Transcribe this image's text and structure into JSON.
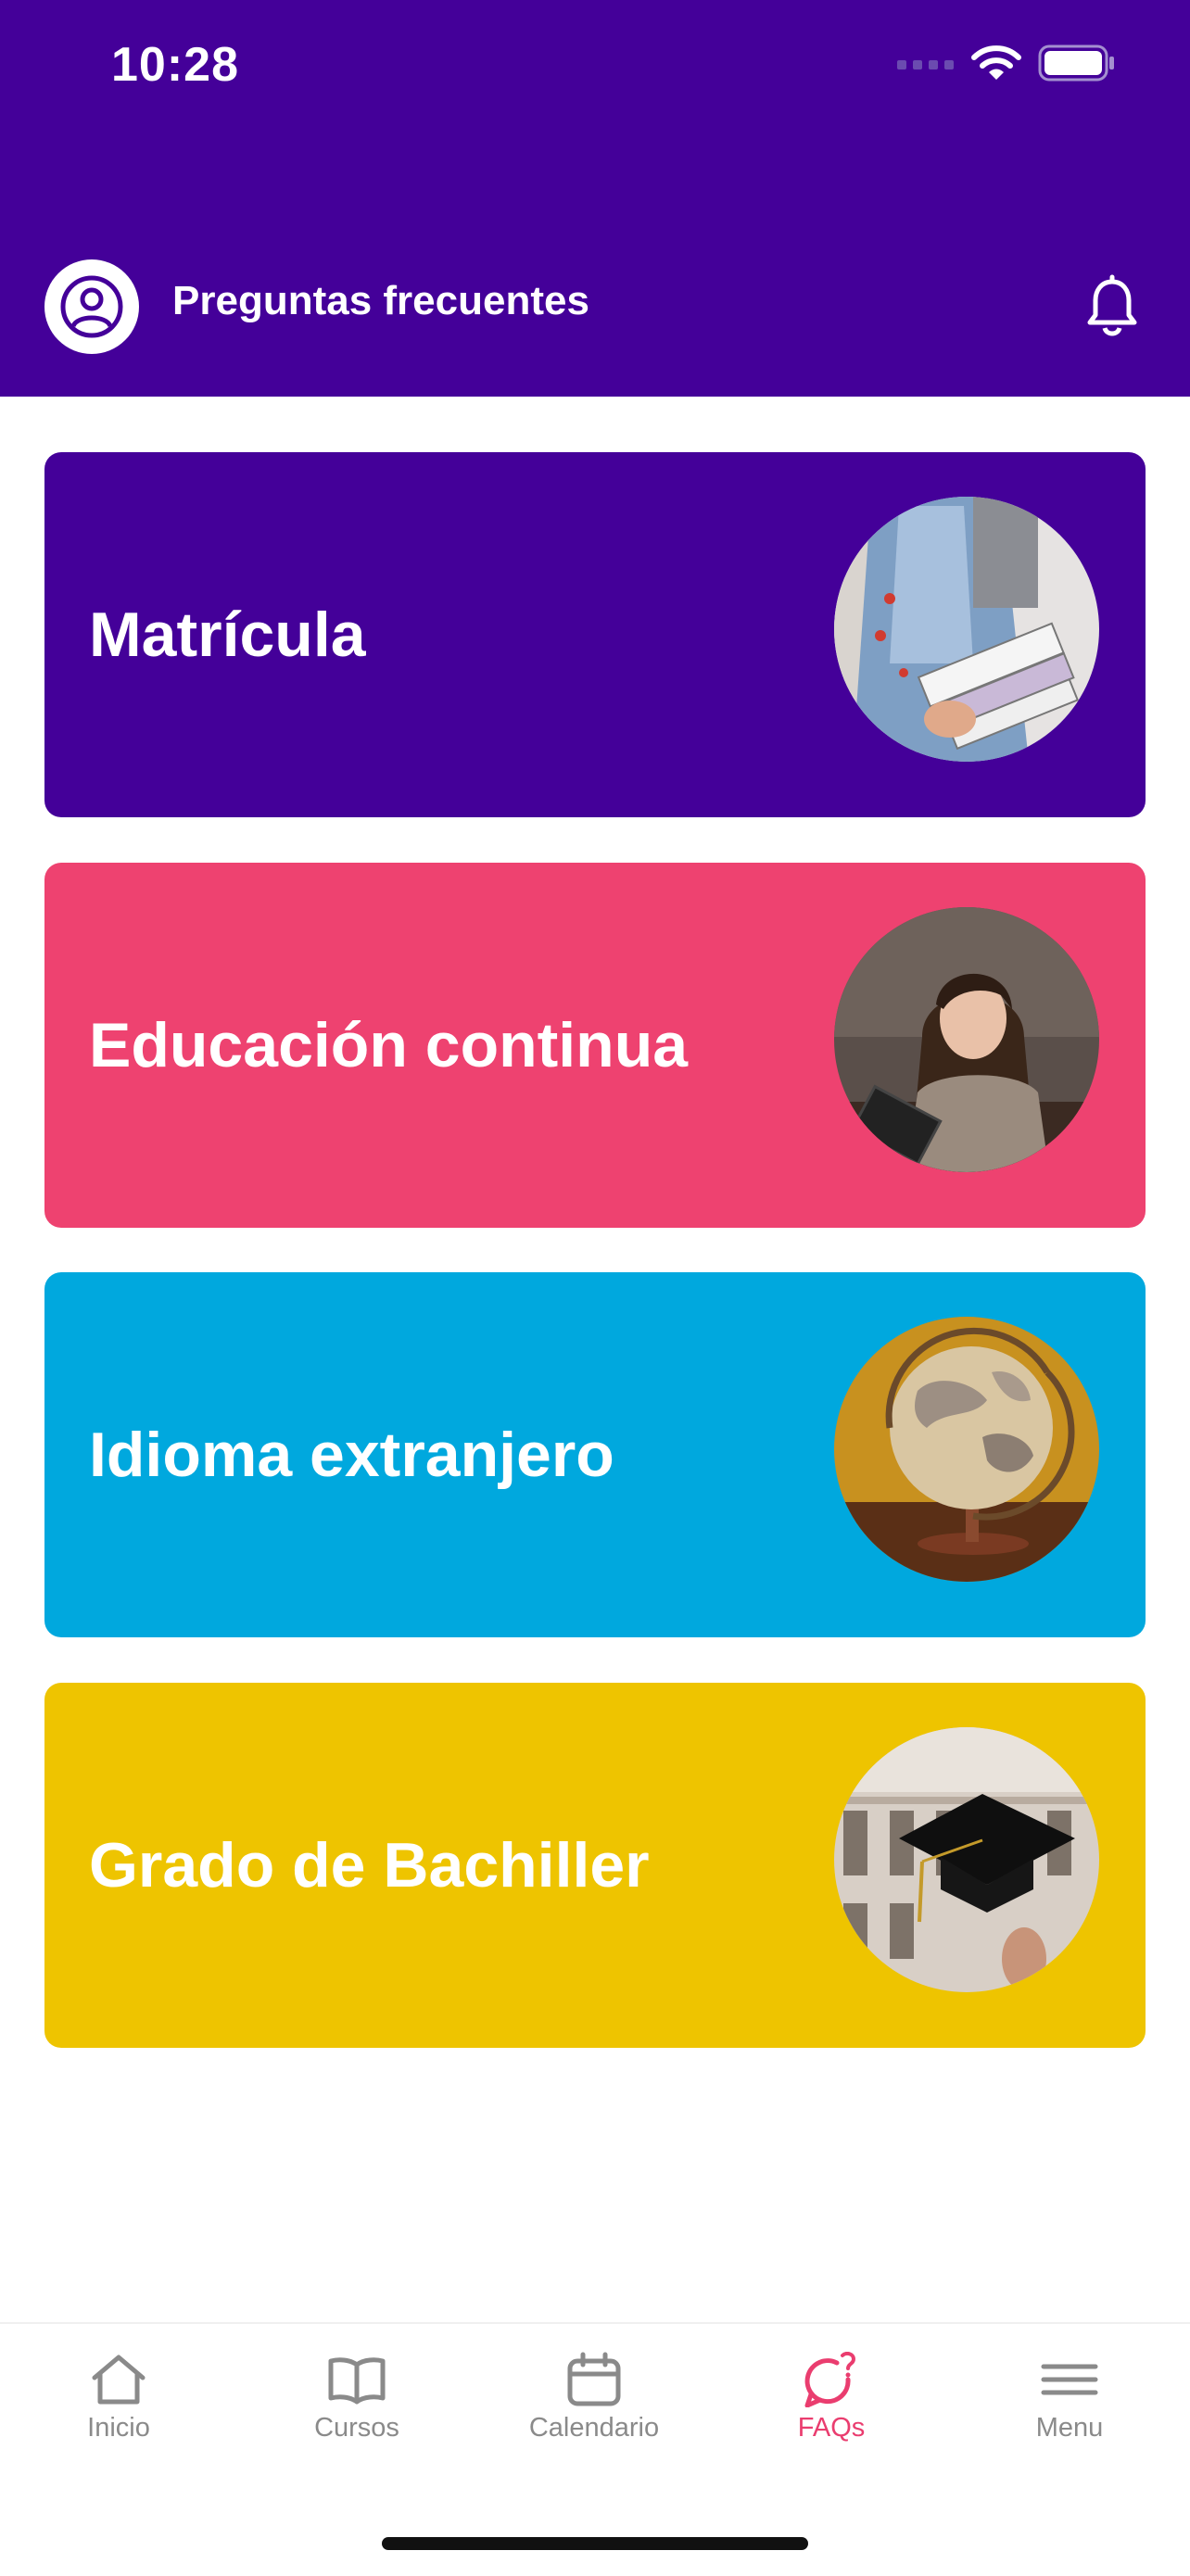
{
  "status_bar": {
    "time": "10:28"
  },
  "header": {
    "title": "Preguntas frecuentes",
    "background": "#440099"
  },
  "cards": [
    {
      "label": "Matrícula",
      "color": "#440099",
      "photo": "student-holding-books-photo"
    },
    {
      "label": "Educación continua",
      "color": "#ee4270",
      "photo": "smiling-woman-with-tablet-photo"
    },
    {
      "label": "Idioma extranjero",
      "color": "#00a8de",
      "photo": "world-globe-photo"
    },
    {
      "label": "Grado de Bachiller",
      "color": "#eec400",
      "photo": "graduation-cap-photo"
    }
  ],
  "tabs": [
    {
      "label": "Inicio",
      "icon": "home-icon"
    },
    {
      "label": "Cursos",
      "icon": "book-icon"
    },
    {
      "label": "Calendario",
      "icon": "calendar-icon"
    },
    {
      "label": "FAQs",
      "icon": "faq-chat-icon",
      "active": true
    },
    {
      "label": "Menu",
      "icon": "menu-icon"
    }
  ],
  "colors": {
    "accent": "#ea3d6f",
    "inactive": "#8a8a8a"
  }
}
